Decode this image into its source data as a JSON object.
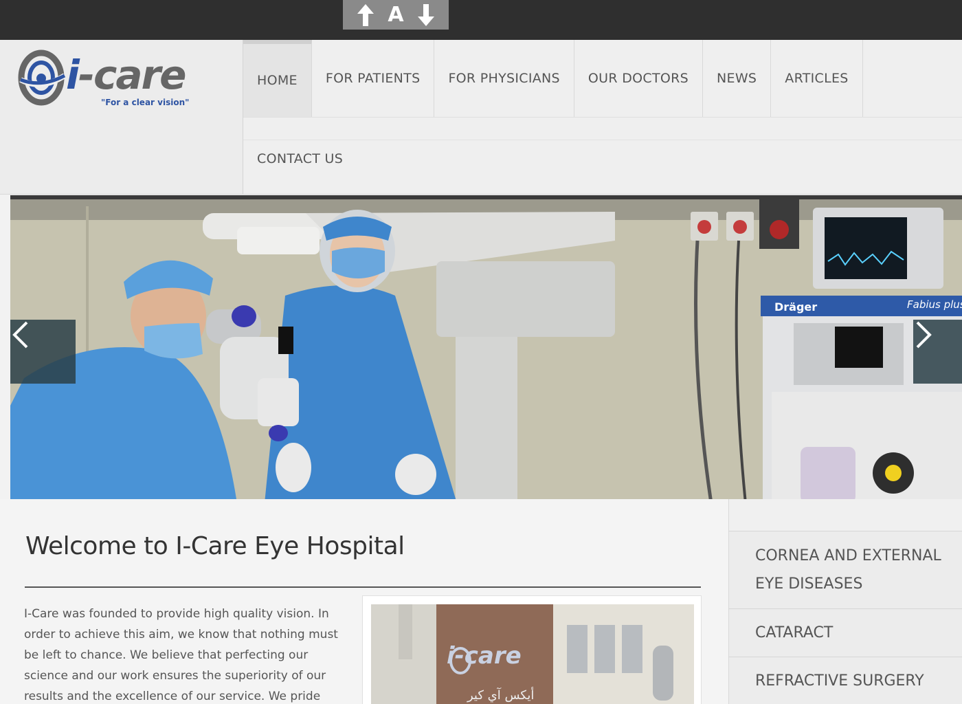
{
  "font_tools": {
    "increase": "⬆",
    "reset": "A",
    "decrease": "⬇"
  },
  "logo": {
    "word_i": "i",
    "word_rest": "-care",
    "tagline": "\"For a clear vision\""
  },
  "nav": {
    "items": [
      {
        "label": "HOME",
        "active": true
      },
      {
        "label": "FOR PATIENTS"
      },
      {
        "label": "FOR PHYSICIANS"
      },
      {
        "label": "OUR DOCTORS"
      },
      {
        "label": "NEWS"
      },
      {
        "label": "ARTICLES"
      }
    ],
    "second_row": [
      {
        "label": "CONTACT US"
      }
    ]
  },
  "slider": {
    "prev_icon": "chevron-left-icon",
    "next_icon": "chevron-right-icon",
    "monitor_brand": "Dräger",
    "monitor_model": "Fabius plus"
  },
  "main": {
    "title": "Welcome to I-Care Eye Hospital",
    "intro": "I-Care was founded to provide high quality vision. In order to achieve this aim, we know that nothing must be left to chance. We believe that perfecting our science and our work ensures the superiority of our results and the excellence of our service. We pride ourselves in our",
    "photo_logo": "i-care",
    "photo_arabic": "أيكس آي كير"
  },
  "sidebar": {
    "items": [
      {
        "label": "CORNEA AND EXTERNAL EYE DISEASES"
      },
      {
        "label": "CATARACT"
      },
      {
        "label": "REFRACTIVE SURGERY"
      }
    ]
  },
  "colors": {
    "brand_blue": "#2e54a3",
    "top_bar": "#2f2f2f",
    "arrow_bg": "#2a4048"
  }
}
